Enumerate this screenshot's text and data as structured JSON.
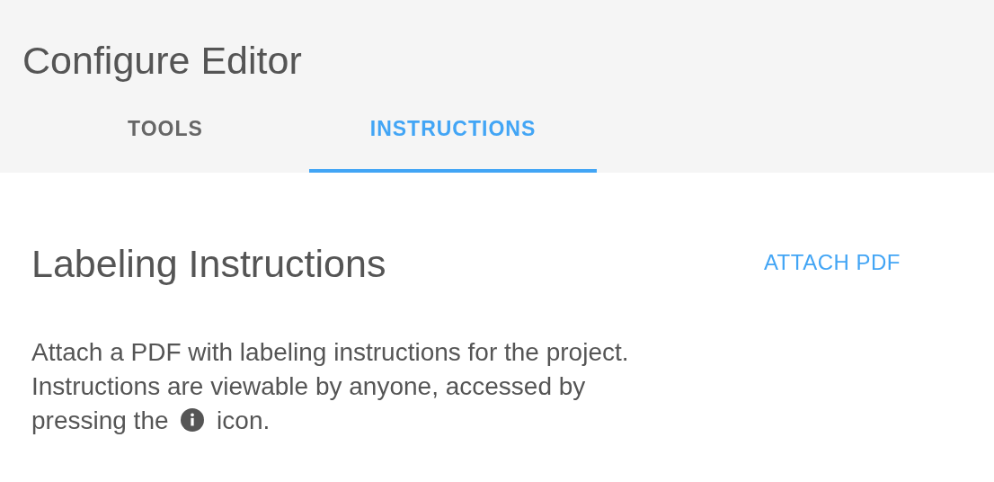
{
  "title": "Configure Editor",
  "tabs": [
    {
      "label": "TOOLS",
      "selected": false
    },
    {
      "label": "INSTRUCTIONS",
      "selected": true
    }
  ],
  "section": {
    "heading": "Labeling Instructions",
    "action": "ATTACH PDF",
    "text_before": "Attach a PDF with labeling instructions for the project. Instructions are viewable by anyone, accessed by pressing the",
    "text_after": "icon."
  }
}
